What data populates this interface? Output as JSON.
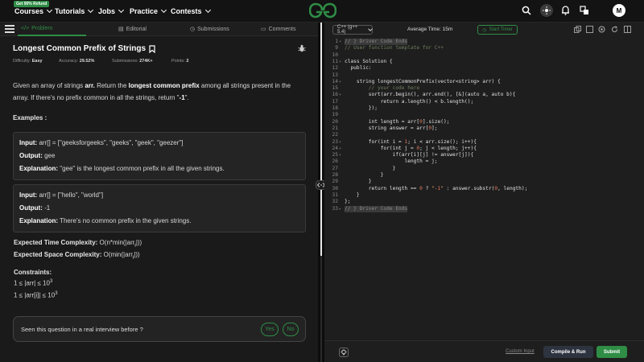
{
  "nav": {
    "badge": "Get 90% Refund",
    "items": [
      "Courses",
      "Tutorials",
      "Jobs",
      "Practice",
      "Contests"
    ],
    "avatar_letter": "M"
  },
  "tabs": {
    "problem": "Problem",
    "editorial": "Editorial",
    "submissions": "Submissions",
    "comments": "Comments"
  },
  "problem": {
    "title": "Longest Common Prefix of Strings",
    "difficulty_label": "Difficulty:",
    "difficulty": "Easy",
    "accuracy_label": "Accuracy:",
    "accuracy": "29.52%",
    "submissions_label": "Submissions:",
    "submissions": "274K+",
    "points_label": "Points:",
    "points": "2",
    "statement": {
      "p1": "Given an array of strings ",
      "arr": "arr.",
      "p2": " Return the ",
      "lcp": "longest common prefix",
      "p3": " among all strings present in the array. If there's no prefix common in all the strings, return \"",
      "neg": "-1",
      "p4": "\"."
    },
    "examples_heading": "Examples :",
    "examples": [
      {
        "input_label": "Input:",
        "input": " arr[] = [\"geeksforgeeks\", \"geeks\", \"geek\", \"geezer\"]",
        "output_label": "Output:",
        "output": " gee",
        "explanation_label": "Explanation:",
        "explanation": " \"gee\" is the longest common prefix in all the given strings."
      },
      {
        "input_label": "Input:",
        "input": " arr[] = [\"hello\", \"world\"]",
        "output_label": "Output:",
        "output": " -1",
        "explanation_label": "Explanation:",
        "explanation": " There's no common prefix in the given strings."
      }
    ],
    "time_label": "Expected Time Complexity:",
    "time": " O(n*min(|arr",
    "time_sub": "i",
    "time_end": "|))",
    "space_label": "Expected Space Complexity:",
    "space": " O(min(|arr",
    "space_sub": "i",
    "space_end": "|))",
    "constraints_heading": "Constraints:",
    "constraint1": "1 ≤ |arr| ≤ 10",
    "constraint1_sup": "3",
    "constraint2": "1 ≤ |arr[i]| ≤ 10",
    "constraint2_sup": "3"
  },
  "seen": {
    "text": "Seen this question in a real interview before ?",
    "yes": "Yes",
    "no": "No"
  },
  "editor": {
    "language": "C++ (g++ 5.4)",
    "avg_time": "Average Time: 15m",
    "timer": "Start Timer",
    "custom_input": "Custom Input",
    "compile_run": "Compile & Run",
    "submit": "Submit"
  },
  "code_lines": [
    {
      "n": "1",
      "t": "// } Driver Code Ends",
      "cls": "cm hl",
      "fold": "▾"
    },
    {
      "n": "9",
      "t": "// User function template for C++",
      "cls": "cm",
      "fold": ""
    },
    {
      "n": "10",
      "t": "",
      "cls": "",
      "fold": ""
    },
    {
      "n": "11",
      "t": "class Solution {",
      "cls": "",
      "fold": "▾"
    },
    {
      "n": "12",
      "t": "  public:",
      "cls": "",
      "fold": ""
    },
    {
      "n": "13",
      "t": "",
      "cls": "",
      "fold": ""
    },
    {
      "n": "14",
      "t": "    string longestCommonPrefix(vector<string> arr) {",
      "cls": "",
      "fold": "▾"
    },
    {
      "n": "15",
      "t": "        // your code here",
      "cls": "cm",
      "fold": ""
    },
    {
      "n": "16",
      "t": "        sort(arr.begin(), arr.end(), [&](auto a, auto b){",
      "cls": "",
      "fold": "▾"
    },
    {
      "n": "17",
      "t": "            return a.length() < b.length();",
      "cls": "",
      "fold": ""
    },
    {
      "n": "18",
      "t": "        });",
      "cls": "",
      "fold": ""
    },
    {
      "n": "19",
      "t": "",
      "cls": "",
      "fold": ""
    },
    {
      "n": "20",
      "t": "        int length = arr[0].size();",
      "cls": "",
      "fold": ""
    },
    {
      "n": "21",
      "t": "        string answer = arr[0];",
      "cls": "",
      "fold": ""
    },
    {
      "n": "22",
      "t": "",
      "cls": "",
      "fold": ""
    },
    {
      "n": "23",
      "t": "        for(int i = 1; i < arr.size(); i++){",
      "cls": "",
      "fold": "▾"
    },
    {
      "n": "24",
      "t": "            for(int j = 0; j < length; j++){",
      "cls": "",
      "fold": "▾"
    },
    {
      "n": "25",
      "t": "                if(arr[i][j] != answer[j]){",
      "cls": "",
      "fold": "▾"
    },
    {
      "n": "26",
      "t": "                    length = j;",
      "cls": "",
      "fold": ""
    },
    {
      "n": "27",
      "t": "                }",
      "cls": "",
      "fold": ""
    },
    {
      "n": "28",
      "t": "            }",
      "cls": "",
      "fold": ""
    },
    {
      "n": "29",
      "t": "        }",
      "cls": "",
      "fold": ""
    },
    {
      "n": "30",
      "t": "        return length == 0 ? \"-1\" : answer.substr(0, length);",
      "cls": "",
      "fold": ""
    },
    {
      "n": "31",
      "t": "    }",
      "cls": "",
      "fold": ""
    },
    {
      "n": "32",
      "t": "};",
      "cls": "",
      "fold": ""
    },
    {
      "n": "33",
      "t": "// } Driver Code Ends",
      "cls": "cm hl",
      "fold": "▸"
    }
  ],
  "colors": {
    "accent": "#2f8d46",
    "background": "#131313"
  },
  "icons": [
    "menu-icon",
    "search-icon",
    "theme-icon",
    "bell-icon",
    "translate-icon",
    "bookmark-icon",
    "bug-icon",
    "fullscreen-icon",
    "settings-icon",
    "reset-icon",
    "bulb-icon"
  ]
}
